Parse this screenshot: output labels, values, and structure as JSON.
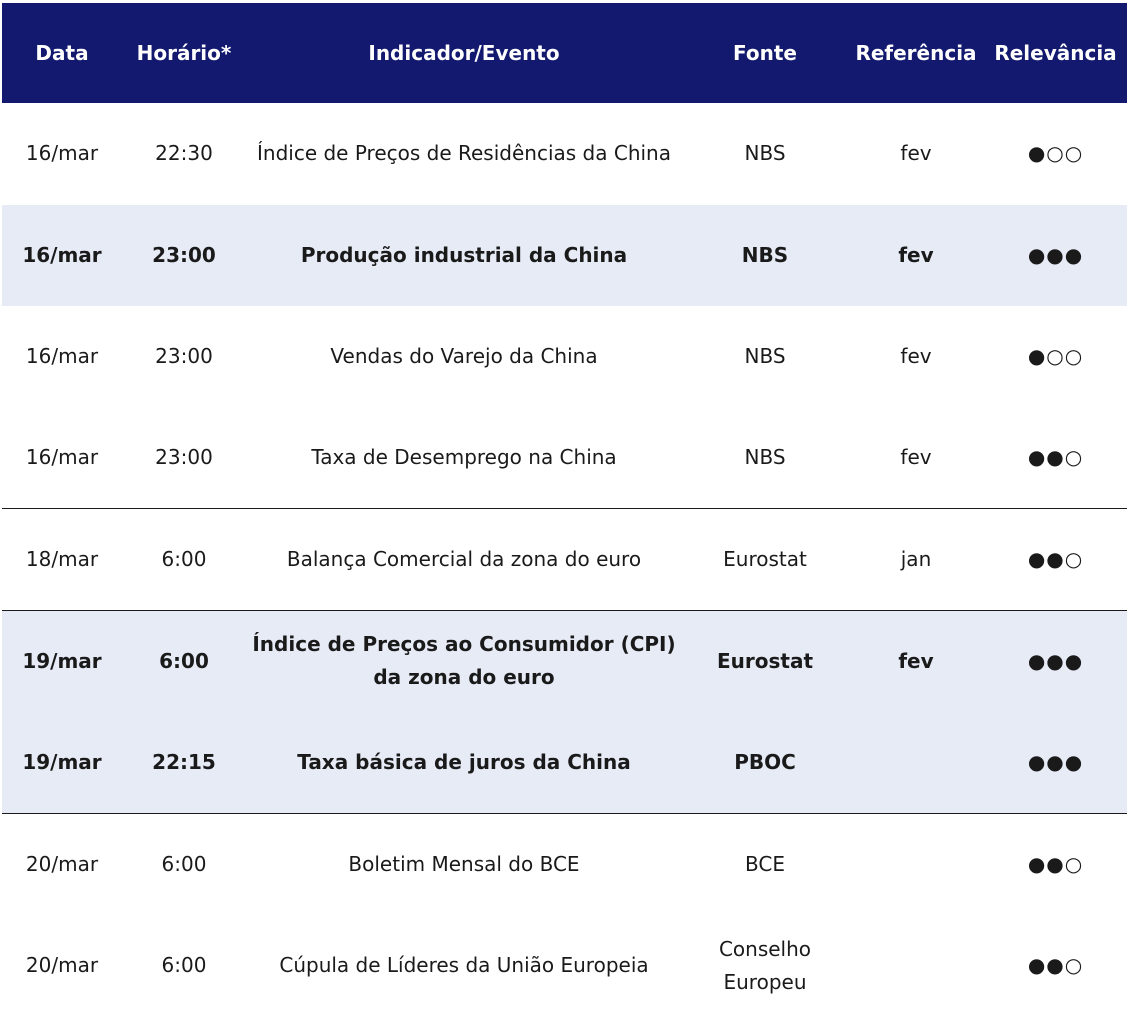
{
  "headers": {
    "data": "Data",
    "horario": "Horário*",
    "indicador": "Indicador/Evento",
    "fonte": "Fonte",
    "referencia": "Referência",
    "relevancia": "Relevância"
  },
  "rows": [
    {
      "data": "16/mar",
      "horario": "22:30",
      "indicador": "Índice de Preços de Residências da China",
      "fonte": "NBS",
      "referencia": "fev",
      "relevancia": "●○○"
    },
    {
      "data": "16/mar",
      "horario": "23:00",
      "indicador": "Produção industrial da China",
      "fonte": "NBS",
      "referencia": "fev",
      "relevancia": "●●●"
    },
    {
      "data": "16/mar",
      "horario": "23:00",
      "indicador": "Vendas do Varejo da China",
      "fonte": "NBS",
      "referencia": "fev",
      "relevancia": "●○○"
    },
    {
      "data": "16/mar",
      "horario": "23:00",
      "indicador": "Taxa de Desemprego na China",
      "fonte": "NBS",
      "referencia": "fev",
      "relevancia": "●●○"
    },
    {
      "data": "18/mar",
      "horario": "6:00",
      "indicador": "Balança Comercial da zona do euro",
      "fonte": "Eurostat",
      "referencia": "jan",
      "relevancia": "●●○"
    },
    {
      "data": "19/mar",
      "horario": "6:00",
      "indicador": "Índice de Preços ao Consumidor (CPI) da zona do euro",
      "fonte": "Eurostat",
      "referencia": "fev",
      "relevancia": "●●●"
    },
    {
      "data": "19/mar",
      "horario": "22:15",
      "indicador": "Taxa básica de juros da China",
      "fonte": "PBOC",
      "referencia": "",
      "relevancia": "●●●"
    },
    {
      "data": "20/mar",
      "horario": "6:00",
      "indicador": "Boletim Mensal do BCE",
      "fonte": "BCE",
      "referencia": "",
      "relevancia": "●●○"
    },
    {
      "data": "20/mar",
      "horario": "6:00",
      "indicador": "Cúpula de Líderes da União Europeia",
      "fonte": "Conselho Europeu",
      "referencia": "",
      "relevancia": "●●○"
    }
  ]
}
